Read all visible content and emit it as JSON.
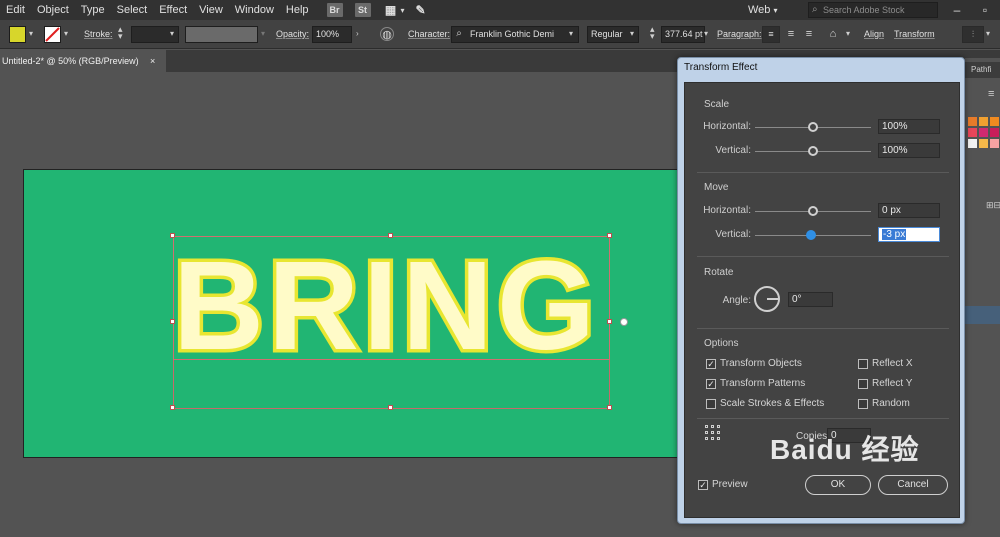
{
  "menubar": {
    "items": [
      "Edit",
      "Object",
      "Type",
      "Select",
      "Effect",
      "View",
      "Window",
      "Help"
    ],
    "bridge_label": "Br",
    "stock_label": "St",
    "workspace": "Web",
    "search_placeholder": "Search Adobe Stock"
  },
  "controlbar": {
    "fill_color": "#d7d62b",
    "stroke_label": "Stroke:",
    "opacity_label": "Opacity:",
    "opacity_value": "100%",
    "character_label": "Character:",
    "font_family": "Franklin Gothic Demi",
    "font_style": "Regular",
    "font_size": "377.64 pt",
    "paragraph_label": "Paragraph:",
    "align_label": "Align",
    "transform_label": "Transform"
  },
  "document": {
    "tab_title": "Untitled-2* @ 50% (RGB/Preview)",
    "close_glyph": "×",
    "artboard_color": "#21b573",
    "text_content": "BRING"
  },
  "dock": {
    "tab_label": "Pathfi",
    "swatches": [
      "#e87b2a",
      "#f0a030",
      "#e8465a",
      "#d02a70",
      "#f2f2f2",
      "#f4b84a",
      "#e0e0e0",
      "#f7a3a3"
    ]
  },
  "dialog": {
    "title": "Transform Effect",
    "scale": {
      "title": "Scale",
      "horizontal_label": "Horizontal:",
      "horizontal_value": "100%",
      "vertical_label": "Vertical:",
      "vertical_value": "100%"
    },
    "move": {
      "title": "Move",
      "horizontal_label": "Horizontal:",
      "horizontal_value": "0 px",
      "vertical_label": "Vertical:",
      "vertical_value": "-3 px"
    },
    "rotate": {
      "title": "Rotate",
      "angle_label": "Angle:",
      "angle_value": "0°"
    },
    "options": {
      "title": "Options",
      "transform_objects": {
        "label": "Transform Objects",
        "checked": true
      },
      "transform_patterns": {
        "label": "Transform Patterns",
        "checked": true
      },
      "scale_strokes": {
        "label": "Scale Strokes & Effects",
        "checked": false
      },
      "reflect_x": {
        "label": "Reflect X",
        "checked": false
      },
      "reflect_y": {
        "label": "Reflect Y",
        "checked": false
      },
      "random": {
        "label": "Random",
        "checked": false
      }
    },
    "copies_label": "Copies",
    "copies_value": "0",
    "preview_label": "Preview",
    "ok_label": "OK",
    "cancel_label": "Cancel",
    "check_glyph": "✓"
  },
  "watermark": "Baidu 经验"
}
